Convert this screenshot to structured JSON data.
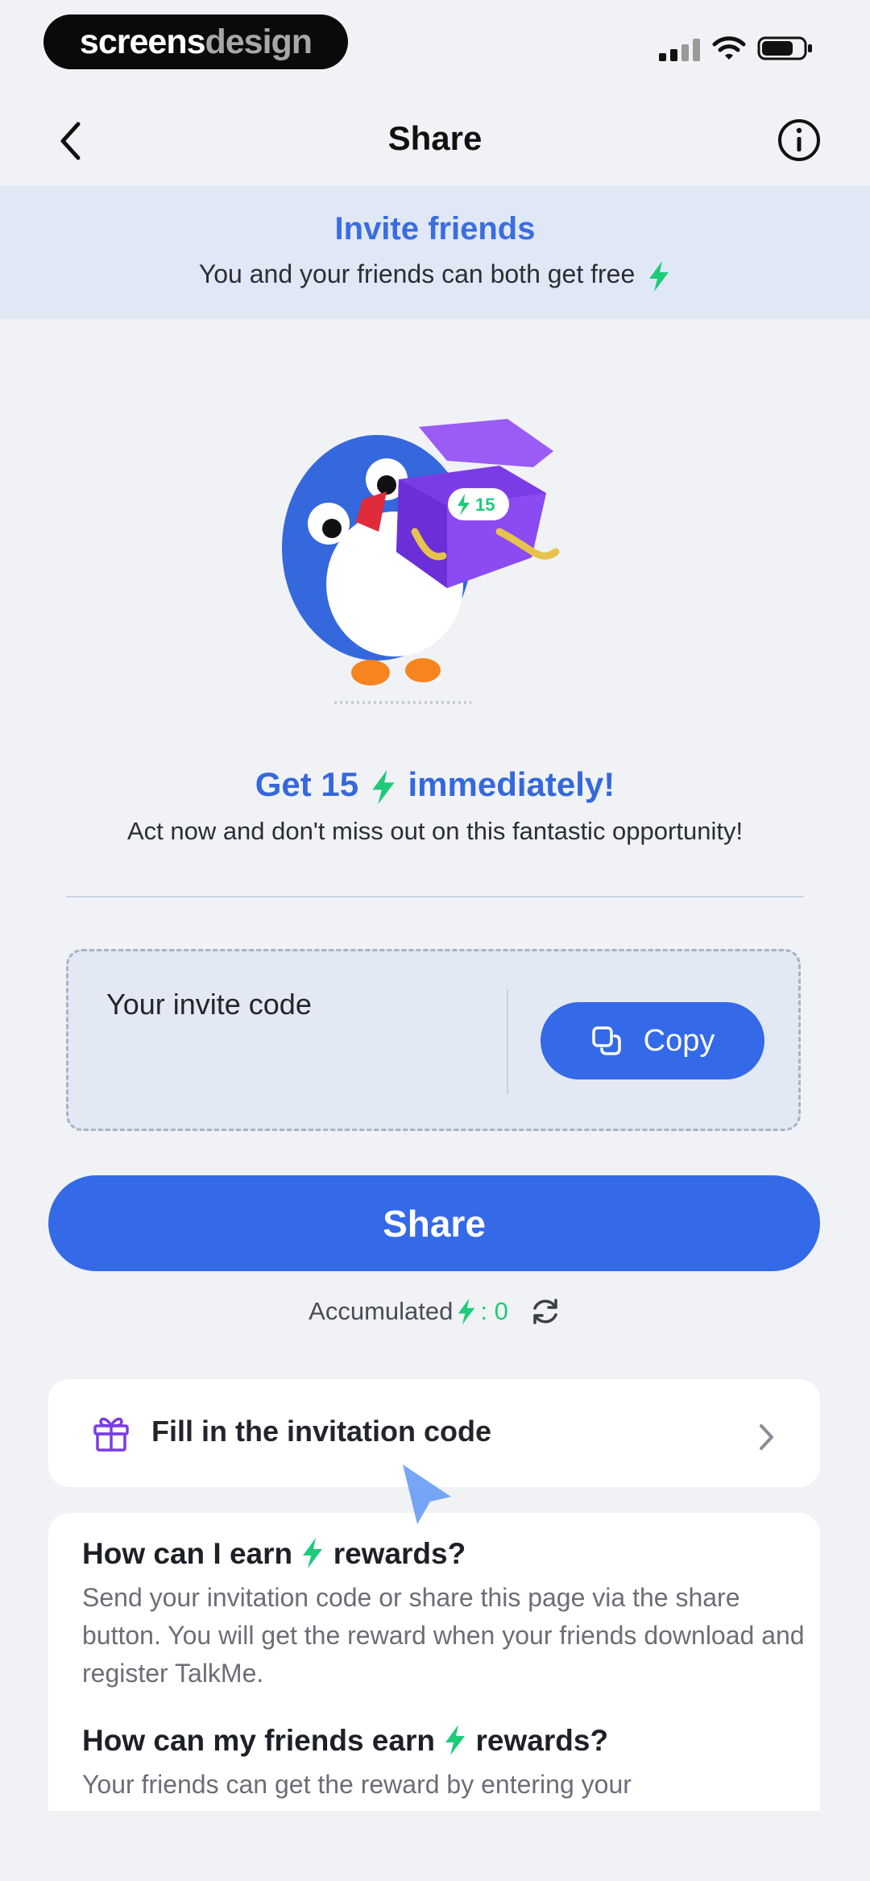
{
  "status_bar": {
    "brand_white": "screens",
    "brand_gray": "design"
  },
  "nav": {
    "title": "Share",
    "back_icon": "chevron-left-icon",
    "info_icon": "info-circle-icon"
  },
  "banner": {
    "title": "Invite friends",
    "subtitle": "You and your friends can both get free"
  },
  "promo": {
    "title_prefix": "Get 15",
    "title_suffix": "immediately!",
    "subtitle": "Act now and don't miss out on this fantastic opportunity!",
    "box_badge": "15"
  },
  "invite_code": {
    "label": "Your invite code",
    "copy_label": "Copy"
  },
  "share_button": "Share",
  "accumulated": {
    "label": "Accumulated",
    "value": ": 0"
  },
  "fill_code": {
    "label": "Fill in the invitation code"
  },
  "faq": [
    {
      "q_prefix": "How can I earn",
      "q_suffix": "rewards?",
      "a": "Send your invitation code or share this page via the share button. You will get the reward when your friends download and register TalkMe."
    },
    {
      "q_prefix": "How can my friends earn",
      "q_suffix": "rewards?",
      "a": "Your friends can get the reward by entering your"
    }
  ],
  "colors": {
    "accent": "#346ae8",
    "bolt": "#1fca7a",
    "banner_bg": "#e0e8f6",
    "page_bg": "#f0f2f5"
  }
}
